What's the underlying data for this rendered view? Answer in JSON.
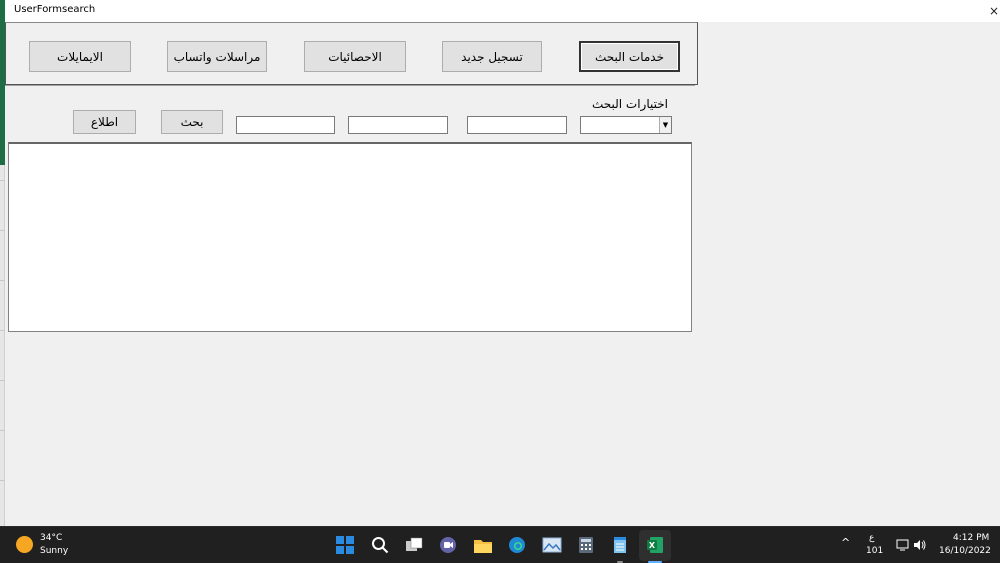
{
  "window": {
    "title": "UserFormsearch",
    "close_glyph": "×"
  },
  "nav": {
    "search_services": "خدمات البحث",
    "new_registration": "تسجيل جديد",
    "statistics": "الاحصائيات",
    "whatsapp_messages": "مراسلات واتساب",
    "emails": "الايمايلات"
  },
  "search": {
    "options_label": "اختيارات البحث",
    "search_button": "بحث",
    "view_button": "اطلاع",
    "combo_arrow": "▼"
  },
  "taskbar": {
    "weather_temp": "34°C",
    "weather_desc": "Sunny",
    "lang": "ع",
    "lang_sub": "101",
    "time": "4:12 PM",
    "date": "16/10/2022",
    "chevron": "^"
  },
  "colors": {
    "excel_green": "#1f6e43",
    "taskbar_bg": "#202020",
    "accent_blue": "#2b8be0"
  }
}
